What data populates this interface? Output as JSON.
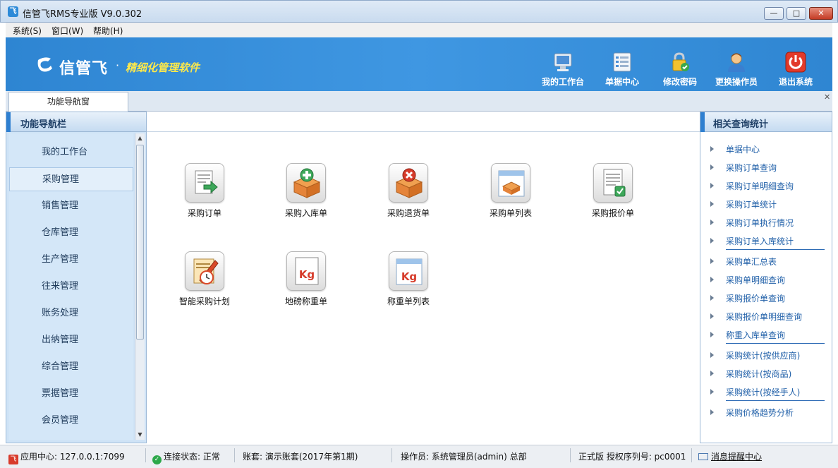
{
  "window": {
    "title": "信管飞RMS专业版 V9.0.302",
    "minimize_glyph": "—",
    "maximize_glyph": "□",
    "close_glyph": "✕"
  },
  "menubar": [
    {
      "label": "系统(S)"
    },
    {
      "label": "窗口(W)"
    },
    {
      "label": "帮助(H)"
    }
  ],
  "banner": {
    "logo_mark": "℃",
    "logo_name": "信管飞",
    "dot": "·",
    "slogan": "精细化管理软件",
    "toolbar": [
      {
        "label": "我的工作台",
        "icon": "monitor-icon",
        "color": "#e8eef5"
      },
      {
        "label": "单据中心",
        "icon": "document-list-icon",
        "color": "#f2f5f9"
      },
      {
        "label": "修改密码",
        "icon": "padlock-icon",
        "color": "#f2c230"
      },
      {
        "label": "更换操作员",
        "icon": "user-icon",
        "color": "#f0a850"
      },
      {
        "label": "退出系统",
        "icon": "power-icon",
        "color": "#e23a2a"
      }
    ]
  },
  "tabs": [
    {
      "label": "功能导航窗"
    }
  ],
  "tab_close_glyph": "✕",
  "leftnav": {
    "header": "功能导航栏",
    "items": [
      {
        "label": "我的工作台"
      },
      {
        "label": "采购管理"
      },
      {
        "label": "销售管理"
      },
      {
        "label": "仓库管理"
      },
      {
        "label": "生产管理"
      },
      {
        "label": "往来管理"
      },
      {
        "label": "账务处理"
      },
      {
        "label": "出纳管理"
      },
      {
        "label": "综合管理"
      },
      {
        "label": "票据管理"
      },
      {
        "label": "会员管理"
      }
    ],
    "active_item": "采购管理"
  },
  "content": {
    "tiles": [
      {
        "label": "采购订单",
        "icon": "purchase-order-icon",
        "color": "#3da85a"
      },
      {
        "label": "采购入库单",
        "icon": "stock-in-box-icon",
        "color": "#e5843a"
      },
      {
        "label": "采购退货单",
        "icon": "return-box-icon",
        "color": "#d63b2a"
      },
      {
        "label": "采购单列表",
        "icon": "order-list-icon",
        "color": "#e6a04a"
      },
      {
        "label": "采购报价单",
        "icon": "quotation-icon",
        "color": "#3da85a"
      },
      {
        "label": "智能采购计划",
        "icon": "smart-plan-icon",
        "color": "#d94a2a"
      },
      {
        "label": "地磅称重单",
        "icon": "weighbridge-kg-icon",
        "color": "#d63b2a"
      },
      {
        "label": "称重单列表",
        "icon": "weigh-list-kg-icon",
        "color": "#d63b2a"
      }
    ],
    "kg_text": "Kg"
  },
  "rightpanel": {
    "header": "相关查询统计",
    "links": [
      {
        "label": "单据中心"
      },
      {
        "label": "采购订单查询"
      },
      {
        "label": "采购订单明细查询"
      },
      {
        "label": "采购订单统计"
      },
      {
        "label": "采购订单执行情况"
      },
      {
        "label": "采购订单入库统计"
      },
      {
        "label": "采购单汇总表"
      },
      {
        "label": "采购单明细查询"
      },
      {
        "label": "采购报价单查询"
      },
      {
        "label": "采购报价单明细查询"
      },
      {
        "label": "称重入库单查询"
      },
      {
        "label": "采购统计(按供应商)"
      },
      {
        "label": "采购统计(按商品)"
      },
      {
        "label": "采购统计(按经手人)"
      },
      {
        "label": "采购价格趋势分析"
      }
    ]
  },
  "statusbar": {
    "app_center": "应用中心: 127.0.0.1:7099",
    "connection": "连接状态: 正常",
    "account_set": "账套: 演示账套(2017年第1期)",
    "operator": "操作员: 系统管理员(admin) 总部",
    "license": "正式版 授权序列号: pc0001",
    "message_center": "消息提醒中心"
  },
  "colors": {
    "banner_blue": "#3a92de",
    "slogan_yellow": "#ffe94a",
    "link_blue": "#1f5fa8"
  }
}
